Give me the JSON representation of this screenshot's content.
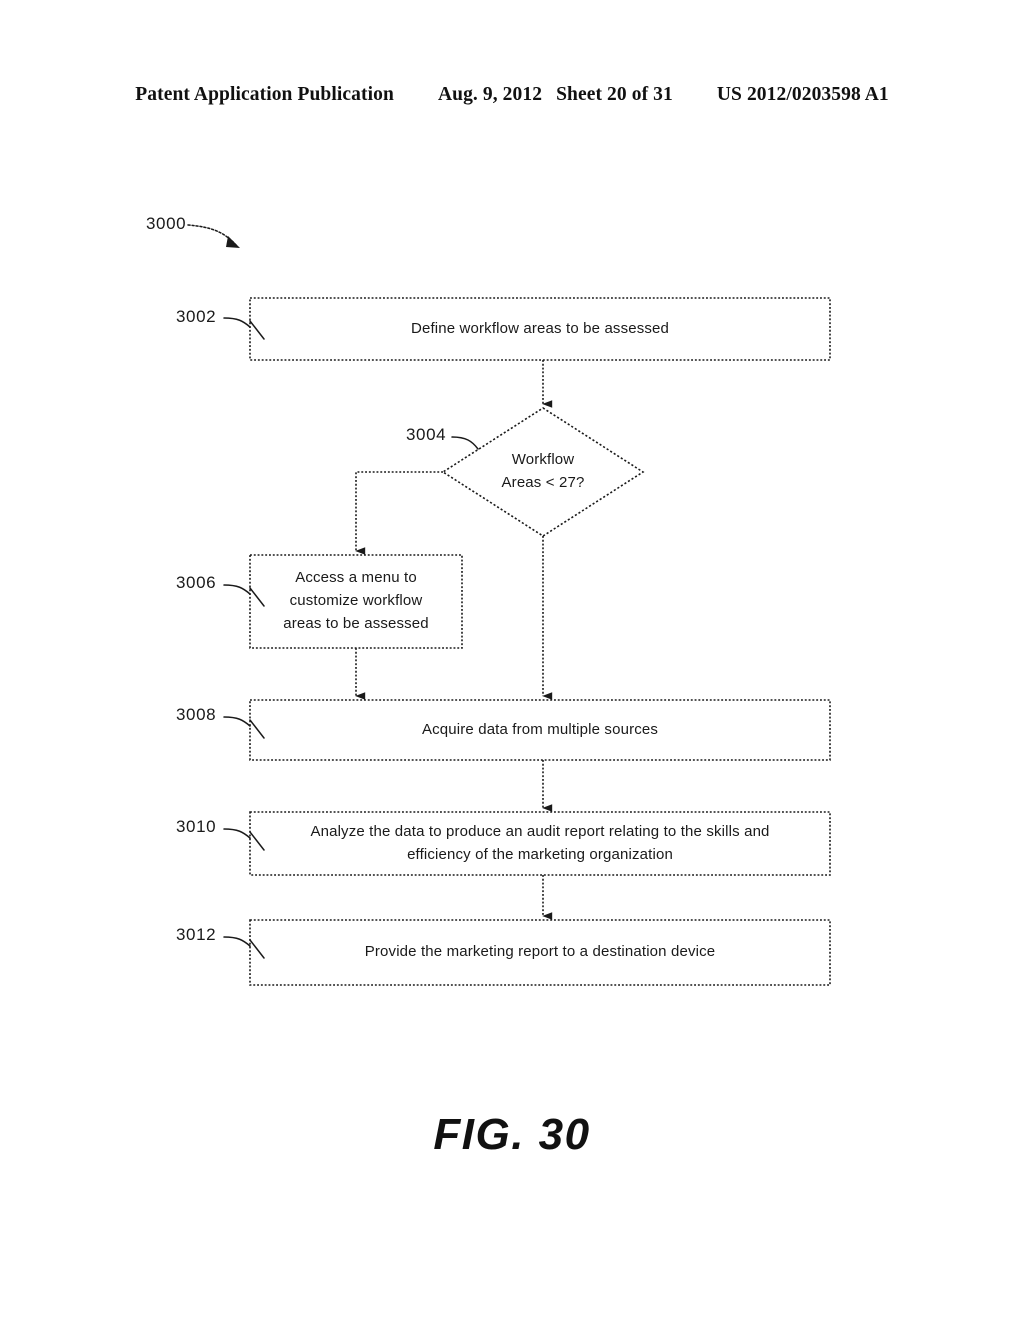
{
  "header": {
    "publication": "Patent Application Publication",
    "date": "Aug. 9, 2012",
    "sheet": "Sheet 20 of 31",
    "patent_number": "US 2012/0203598 A1"
  },
  "figure": {
    "caption": "FIG. 30",
    "diagram_ref": "3000"
  },
  "flowchart": {
    "type": "flowchart",
    "nodes": [
      {
        "ref": "3002",
        "shape": "process",
        "lines": [
          "Define workflow areas to be assessed"
        ]
      },
      {
        "ref": "3004",
        "shape": "decision",
        "lines": [
          "Workflow",
          "Areas < 27?"
        ]
      },
      {
        "ref": "3006",
        "shape": "process",
        "lines": [
          "Access a menu to",
          "customize workflow",
          "areas to be assessed"
        ]
      },
      {
        "ref": "3008",
        "shape": "process",
        "lines": [
          "Acquire data from multiple sources"
        ]
      },
      {
        "ref": "3010",
        "shape": "process",
        "lines": [
          "Analyze the data to produce an audit report relating to the skills and",
          "efficiency of the marketing organization"
        ]
      },
      {
        "ref": "3012",
        "shape": "process",
        "lines": [
          "Provide the marketing report to a destination device"
        ]
      }
    ]
  },
  "style": {
    "ink": "#1a1a1a",
    "paper": "#ffffff"
  }
}
